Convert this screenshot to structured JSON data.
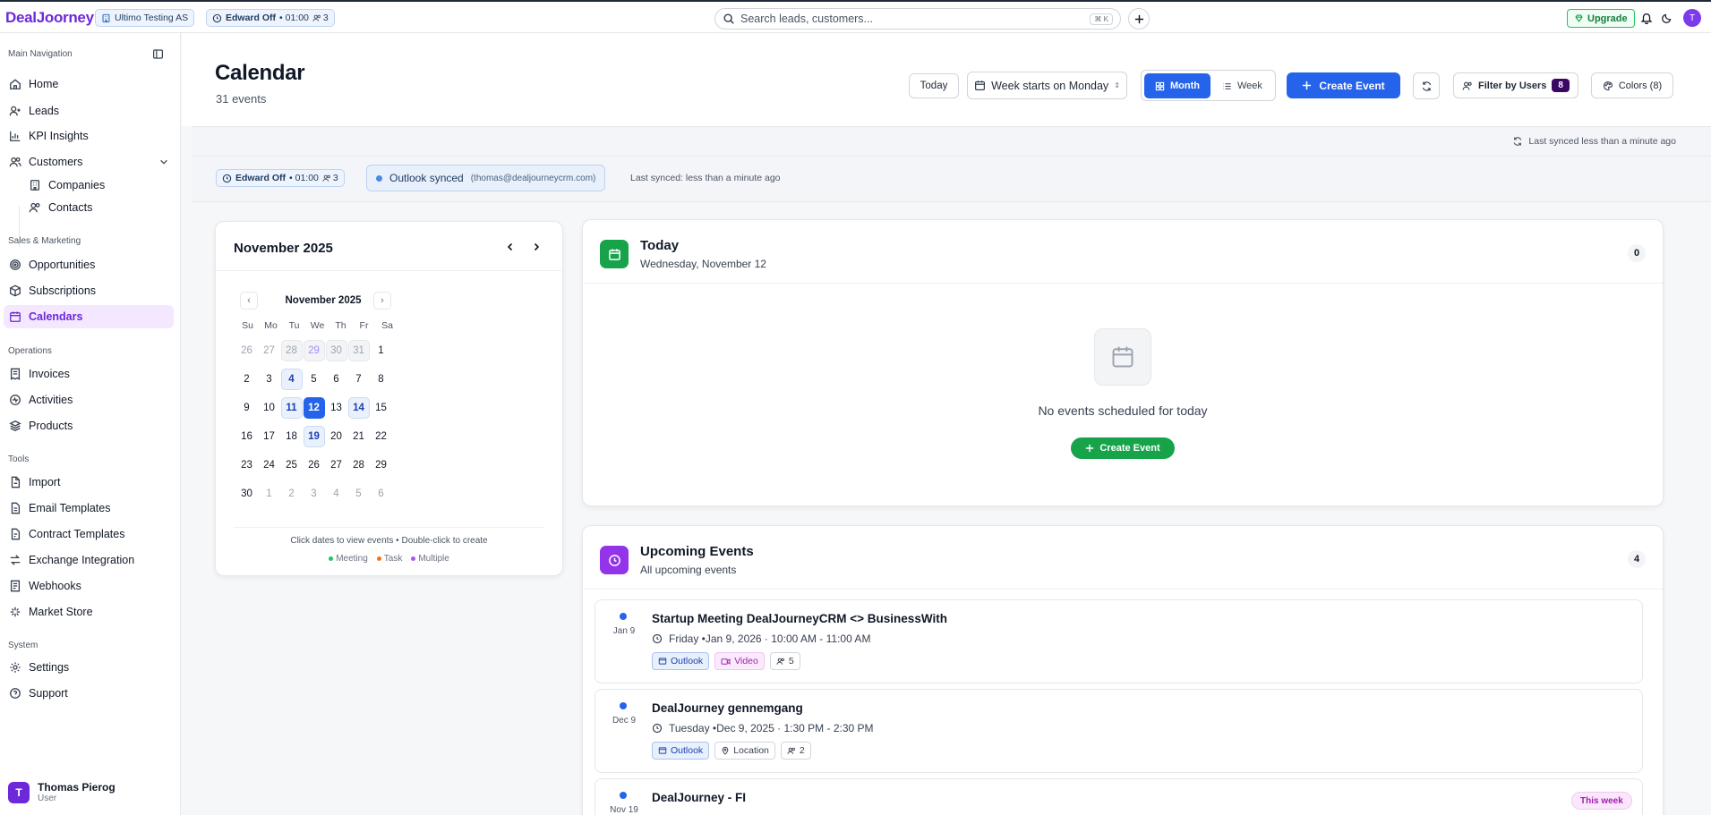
{
  "topbar": {
    "logo": "DealJoorney",
    "org_pill": "Ultimo Testing AS",
    "timer_name": "Edward Off",
    "timer_time": "• 01:00",
    "timer_users": "3",
    "search_placeholder": "Search leads, customers...",
    "search_shortcut": "K",
    "upgrade_label": "Upgrade",
    "avatar_initial": "T"
  },
  "sidebar": {
    "main_title": "Main Navigation",
    "items_main": [
      {
        "label": "Home",
        "icon": "home-icon"
      },
      {
        "label": "Leads",
        "icon": "user-plus-icon"
      },
      {
        "label": "KPI Insights",
        "icon": "chart-icon"
      },
      {
        "label": "Customers",
        "icon": "users-icon"
      },
      {
        "label": "Companies",
        "icon": "building-icon"
      },
      {
        "label": "Contacts",
        "icon": "contacts-icon"
      }
    ],
    "section_sales": "Sales & Marketing",
    "items_sales": [
      {
        "label": "Opportunities",
        "icon": "target-icon"
      },
      {
        "label": "Subscriptions",
        "icon": "package-icon"
      },
      {
        "label": "Calendars",
        "icon": "calendar-icon"
      }
    ],
    "section_ops": "Operations",
    "items_ops": [
      {
        "label": "Invoices",
        "icon": "receipt-icon"
      },
      {
        "label": "Activities",
        "icon": "activity-icon"
      },
      {
        "label": "Products",
        "icon": "layers-icon"
      }
    ],
    "section_tools": "Tools",
    "items_tools": [
      {
        "label": "Import",
        "icon": "file-import-icon"
      },
      {
        "label": "Email Templates",
        "icon": "mail-template-icon"
      },
      {
        "label": "Contract Templates",
        "icon": "contract-icon"
      },
      {
        "label": "Exchange Integration",
        "icon": "exchange-icon"
      },
      {
        "label": "Webhooks",
        "icon": "webhook-icon"
      },
      {
        "label": "Market Store",
        "icon": "store-icon"
      }
    ],
    "section_system": "System",
    "items_system": [
      {
        "label": "Settings",
        "icon": "gear-icon"
      },
      {
        "label": "Support",
        "icon": "help-icon"
      }
    ],
    "user": {
      "initial": "T",
      "name": "Thomas Pierog",
      "role": "User"
    }
  },
  "header": {
    "title": "Calendar",
    "subtitle": "31 events",
    "today_label": "Today",
    "week_start_label": "Week starts on Monday",
    "month_label": "Month",
    "week_label": "Week",
    "create_label": "Create Event",
    "filter_label": "Filter by Users",
    "filter_count": "8",
    "colors_label": "Colors (8)"
  },
  "sync": {
    "last_synced": "Last synced less than a minute ago",
    "timer_name": "Edward Off",
    "timer_time": "• 01:00",
    "timer_users": "3",
    "outlook_label": "Outlook synced",
    "outlook_email": "(thomas@dealjourneycrm.com)",
    "last_synced_inline": "Last synced: less than a minute ago"
  },
  "mini_calendar": {
    "title": "November 2025",
    "inner_title": "November 2025",
    "weekdays": [
      "Su",
      "Mo",
      "Tu",
      "We",
      "Th",
      "Fr",
      "Sa"
    ],
    "weeks": [
      [
        "26",
        "27",
        "28",
        "29",
        "30",
        "31",
        "1"
      ],
      [
        "2",
        "3",
        "4",
        "5",
        "6",
        "7",
        "8"
      ],
      [
        "9",
        "10",
        "11",
        "12",
        "13",
        "14",
        "15"
      ],
      [
        "16",
        "17",
        "18",
        "19",
        "20",
        "21",
        "22"
      ],
      [
        "23",
        "24",
        "25",
        "26",
        "27",
        "28",
        "29"
      ],
      [
        "30",
        "1",
        "2",
        "3",
        "4",
        "5",
        "6"
      ]
    ],
    "hint": "Click dates to view events • Double-click to create",
    "legend": [
      {
        "label": "Meeting",
        "color": "#22c55e"
      },
      {
        "label": "Task",
        "color": "#f97316"
      },
      {
        "label": "Multiple",
        "color": "#a855f7"
      }
    ]
  },
  "today": {
    "title": "Today",
    "date": "Wednesday, November 12",
    "count": "0",
    "empty_text": "No events scheduled for today",
    "create_label": "Create Event"
  },
  "upcoming": {
    "title": "Upcoming Events",
    "subtitle": "All upcoming events",
    "count": "4",
    "events": [
      {
        "date": "Jan 9",
        "title": "Startup Meeting DealJourneyCRM <> BusinessWith",
        "when": "Friday •Jan 9, 2026 · 10:00 AM - 11:00 AM",
        "tag1": "Outlook",
        "tag2": "Video",
        "attendees": "5"
      },
      {
        "date": "Dec 9",
        "title": "DealJourney gennemgang",
        "when": "Tuesday •Dec 9, 2025 · 1:30 PM - 2:30 PM",
        "tag1": "Outlook",
        "tag2": "Location",
        "attendees": "2"
      },
      {
        "date": "Nov 19",
        "title": "DealJourney - FI",
        "badge": "This week"
      }
    ]
  },
  "colors": {
    "accent": "#2563eb",
    "brand": "#6d28d9",
    "success": "#16a34a"
  }
}
